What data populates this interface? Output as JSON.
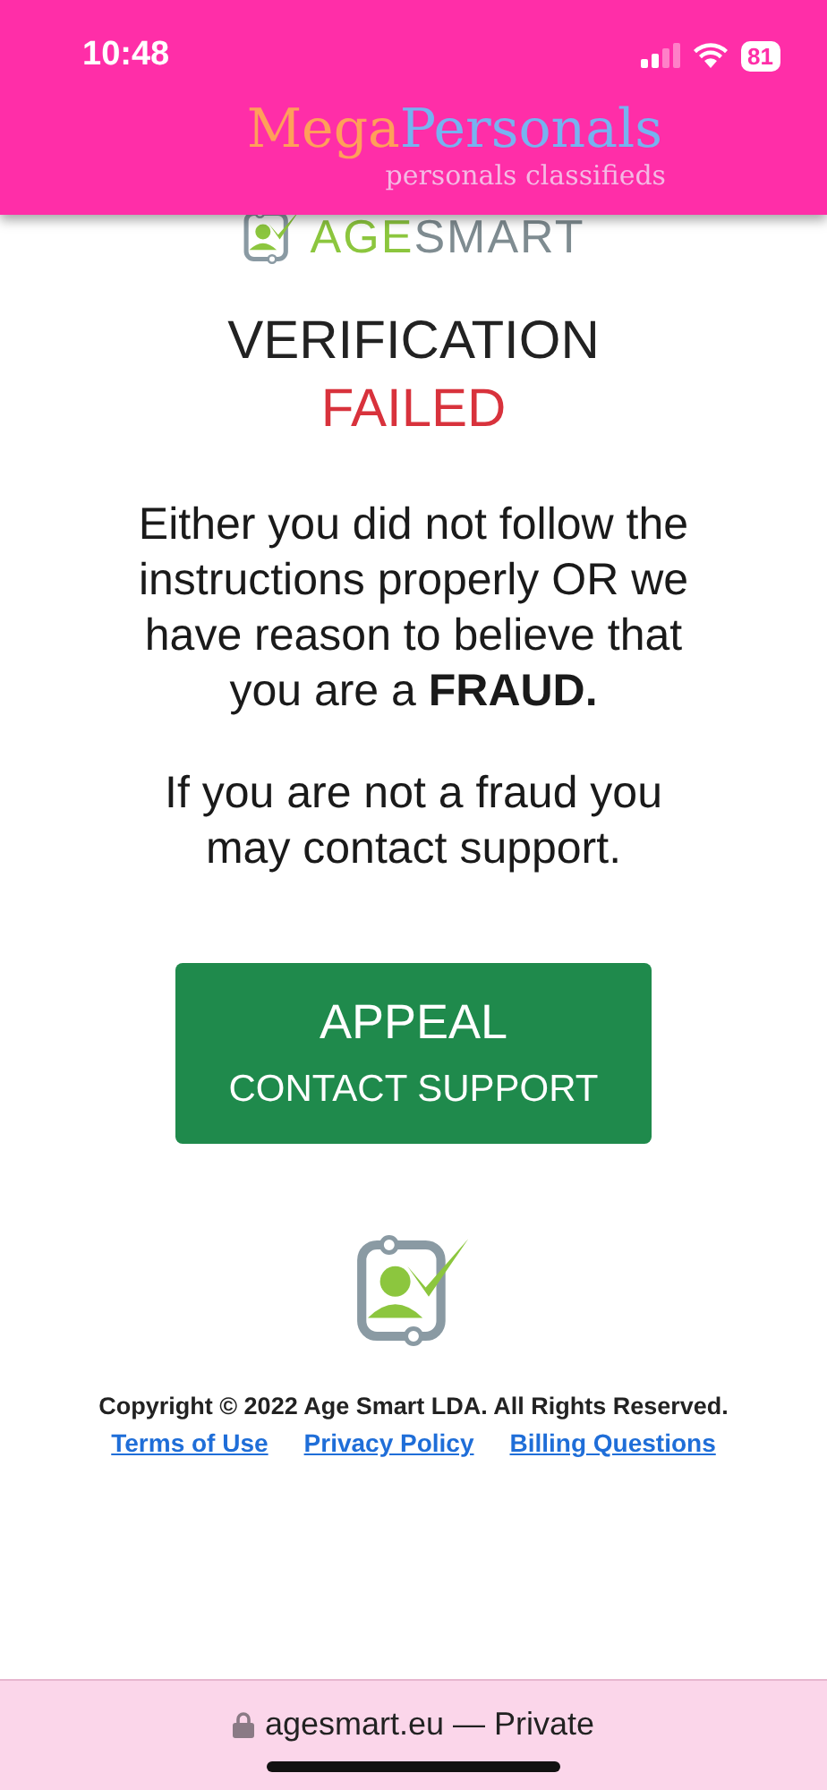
{
  "status_bar": {
    "time": "10:48",
    "battery": "81"
  },
  "header": {
    "brand_first": "Mega",
    "brand_second": "Personals",
    "tagline": "personals classifieds"
  },
  "agesmart_logo": {
    "first": "AGE",
    "second": "SMART"
  },
  "heading": {
    "line_1": "VERIFICATION",
    "line_2": "FAILED"
  },
  "message": "Either you did not follow the instructions properly OR we have reason to believe that you are a **FRAUD.**",
  "support_note": "If you are not a fraud you may contact support.",
  "appeal_button": {
    "line_1": "APPEAL",
    "line_2": "CONTACT SUPPORT"
  },
  "footer": {
    "copyright": "Copyright © 2022 Age Smart LDA. All Rights Reserved.",
    "links": [
      "Terms of Use",
      "Privacy Policy",
      "Billing Questions"
    ]
  },
  "address_bar": {
    "url": "agesmart.eu — Private"
  }
}
